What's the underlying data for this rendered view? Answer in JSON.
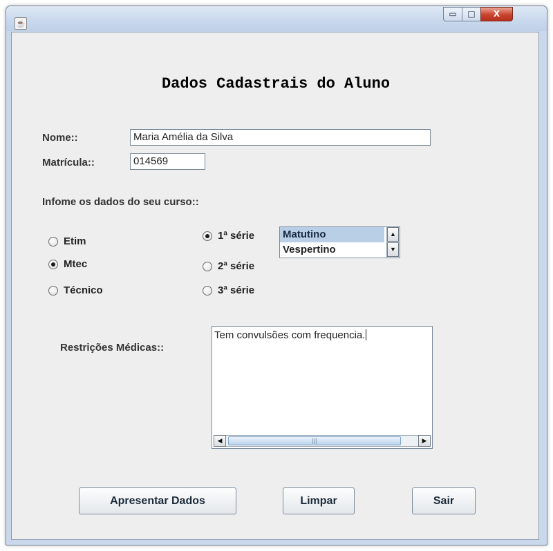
{
  "window": {
    "icon": "java-icon",
    "controls": {
      "minimize": "▭",
      "maximize": "□",
      "close": "X"
    }
  },
  "form": {
    "title": "Dados Cadastrais do Aluno",
    "nome_label": "Nome::",
    "nome_value": "Maria Amélia da Silva",
    "matricula_label": "Matrícula::",
    "matricula_value": "014569",
    "curso_label": "Infome os dados do seu curso::",
    "curso_options": [
      "Etim",
      "Mtec",
      "Técnico"
    ],
    "curso_selected": "Mtec",
    "serie_options": [
      "1ª série",
      "2ª série",
      "3ª série"
    ],
    "serie_selected": "1ª série",
    "turno_list": [
      "Matutino",
      "Vespertino"
    ],
    "turno_selected": "Matutino",
    "restricoes_label": "Restrições Médicas::",
    "restricoes_value": "Tem convulsões com frequencia."
  },
  "buttons": {
    "apresentar": "Apresentar Dados",
    "limpar": "Limpar",
    "sair": "Sair"
  },
  "icons": {
    "radio_on": "radio-selected-icon",
    "radio_off": "radio-unselected-icon",
    "scroll_up": "arrow-up-icon",
    "scroll_down": "arrow-down-icon",
    "scroll_left": "arrow-left-icon",
    "scroll_right": "arrow-right-icon"
  },
  "colors": {
    "client_bg": "#eeeeee",
    "selected_list_item": "#b8cfe5",
    "close_button": "#c9432e"
  }
}
